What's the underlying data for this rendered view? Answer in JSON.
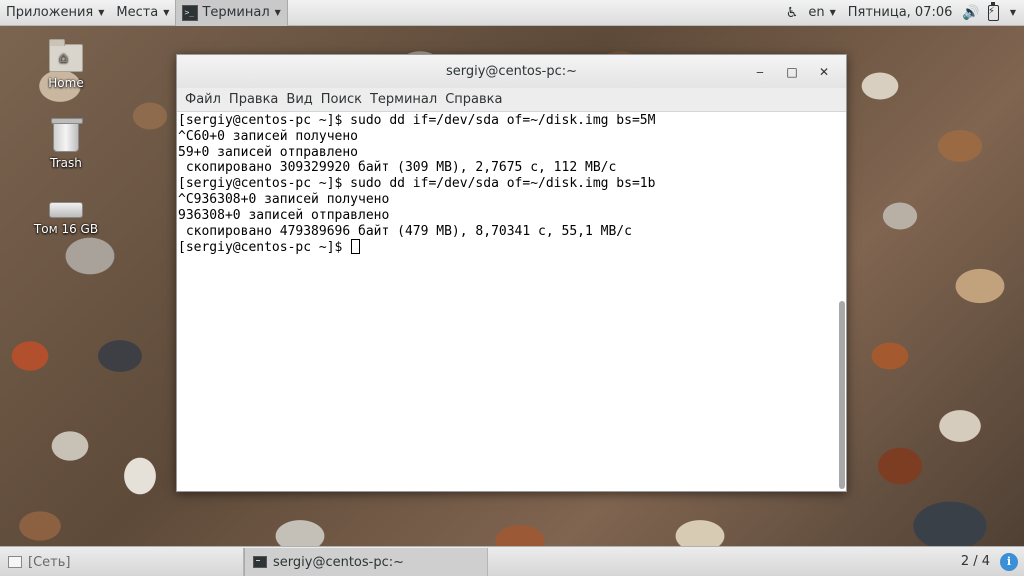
{
  "top_panel": {
    "applications_label": "Приложения",
    "places_label": "Места",
    "terminal_label": "Терминал",
    "language": "en",
    "clock": "Пятница, 07:06"
  },
  "desktop": {
    "icons": [
      {
        "label": "Home",
        "icon": "home-folder-icon"
      },
      {
        "label": "Trash",
        "icon": "trash-icon"
      },
      {
        "label": "Том 16 GB",
        "icon": "drive-icon"
      }
    ]
  },
  "window": {
    "title": "sergiy@centos-pc:~",
    "controls": {
      "minimize": "‒",
      "maximize": "□",
      "close": "✕"
    },
    "menu": [
      "Файл",
      "Правка",
      "Вид",
      "Поиск",
      "Терминал",
      "Справка"
    ],
    "terminal_lines": [
      "[sergiy@centos-pc ~]$ sudo dd if=/dev/sda of=~/disk.img bs=5M",
      "^C60+0 записей получено",
      "59+0 записей отправлено",
      " скопировано 309329920 байт (309 MB), 2,7675 c, 112 MB/c",
      "[sergiy@centos-pc ~]$ sudo dd if=/dev/sda of=~/disk.img bs=1b",
      "^C936308+0 записей получено",
      "936308+0 записей отправлено",
      " скопировано 479389696 байт (479 MB), 8,70341 c, 55,1 MB/c"
    ],
    "prompt": "[sergiy@centos-pc ~]$ "
  },
  "taskbar": {
    "tasks": [
      {
        "label": "[Сеть]"
      },
      {
        "label": "sergiy@centos-pc:~"
      }
    ],
    "workspace": "2 / 4",
    "info_badge": "i"
  },
  "colors": {
    "panel_bg": "#e4e4e4",
    "terminal_bg": "#ffffff",
    "terminal_fg": "#000000",
    "info_badge": "#3a8fd6"
  }
}
